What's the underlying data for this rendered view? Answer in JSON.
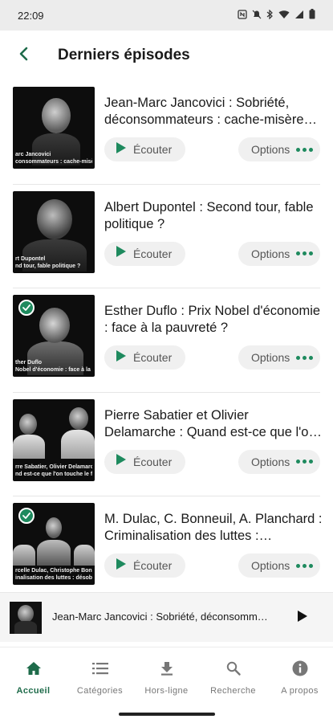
{
  "status_bar": {
    "time": "22:09"
  },
  "header": {
    "title": "Derniers épisodes"
  },
  "episodes": [
    {
      "title": "Jean-Marc Jancovici : Sobriété, déconsommateurs : cache-misère des gros pollueurs ?",
      "thumb_caption_1": "arc Jancovici",
      "thumb_caption_2": "consommateurs : cache-misère des gro",
      "listened": false,
      "listen_label": "Écouter",
      "options_label": "Options"
    },
    {
      "title": "Albert Dupontel : Second tour, fable politique ?",
      "thumb_caption_1": "rt Dupontel",
      "thumb_caption_2": "nd tour, fable politique ?",
      "listened": false,
      "listen_label": "Écouter",
      "options_label": "Options"
    },
    {
      "title": "Esther Duflo : Prix Nobel d'économie : face à la pauvreté ?",
      "thumb_caption_1": "ther Duflo",
      "thumb_caption_2": "Nobel d'économie : face à la pau",
      "listened": true,
      "listen_label": "Écouter",
      "options_label": "Options"
    },
    {
      "title": "Pierre Sabatier et Olivier Delamarche : Quand est-ce que l'on touche le fond ?",
      "thumb_caption_1": "rre Sabatier, Olivier Delamarche",
      "thumb_caption_2": "nd est-ce que l'on touche le fond ?",
      "listened": false,
      "listen_label": "Écouter",
      "options_label": "Options"
    },
    {
      "title": "M. Dulac, C. Bonneuil, A. Planchard : Criminalisation des luttes : désobéissance ?",
      "thumb_caption_1": "rcelle Dulac, Christophe Bonneuil et Ant",
      "thumb_caption_2": "inalisation des luttes : désobéissance ?",
      "listened": true,
      "listen_label": "Écouter",
      "options_label": "Options"
    }
  ],
  "mini_player": {
    "title": "Jean-Marc Jancovici : Sobriété, déconsommateurs : cache-misère des gros pollueurs ?"
  },
  "bottom_nav": {
    "items": [
      {
        "label": "Accueil",
        "icon": "home-icon",
        "active": true
      },
      {
        "label": "Catégories",
        "icon": "list-icon",
        "active": false
      },
      {
        "label": "Hors-ligne",
        "icon": "download-icon",
        "active": false
      },
      {
        "label": "Recherche",
        "icon": "search-icon",
        "active": false
      },
      {
        "label": "A propos",
        "icon": "info-icon",
        "active": false
      }
    ]
  },
  "colors": {
    "accent": "#1e8a5e",
    "accent_dark": "#1e6b4a",
    "pill_bg": "#f0f0f0"
  }
}
